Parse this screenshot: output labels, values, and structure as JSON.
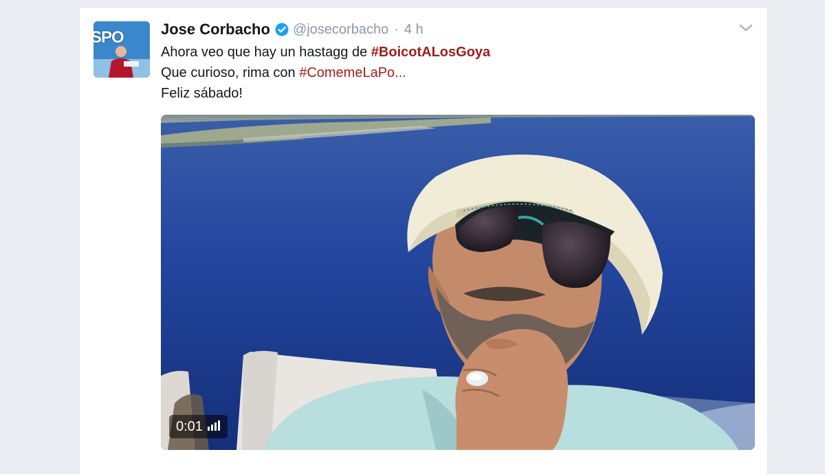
{
  "tweet": {
    "author_name": "Jose Corbacho",
    "handle": "@josecorbacho",
    "separator": "·",
    "time": "4 h",
    "avatar_label": "SPO",
    "line1_prefix": "Ahora veo que hay un hastagg de ",
    "hashtag1": "#BoicotALosGoya",
    "line2_prefix": "Que curioso, rima con ",
    "hashtag2": "#ComemeLaPo",
    "line2_suffix": "...",
    "line3": "Feliz sábado!"
  },
  "media": {
    "type": "video",
    "duration_label": "0:01",
    "volume_icon": "volume-bars-icon"
  },
  "colors": {
    "hashtag": "#a01c1c",
    "verified_badge": "#1da1f2",
    "muted_text": "#8b98a5",
    "page_background": "#e9edf2",
    "card_background": "#ffffff"
  }
}
